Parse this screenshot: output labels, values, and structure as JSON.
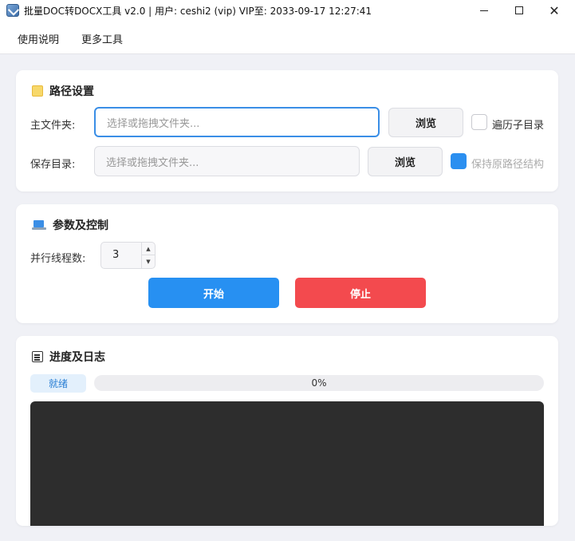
{
  "window": {
    "title": "批量DOC转DOCX工具 v2.0  |  用户: ceshi2 (vip) VIP至: 2033-09-17 12:27:41",
    "minimize_label": "",
    "maximize_label": "",
    "close_label": "✕"
  },
  "menu": {
    "items": [
      {
        "label": "使用说明"
      },
      {
        "label": "更多工具"
      }
    ]
  },
  "path_section": {
    "title": "路径设置",
    "main_folder_label": "主文件夹:",
    "main_folder_placeholder": "选择或拖拽文件夹...",
    "browse_label": "浏览",
    "recurse_label": "遍历子目录",
    "recurse_checked": false,
    "save_dir_label": "保存目录:",
    "save_dir_placeholder": "选择或拖拽文件夹...",
    "keep_structure_label": "保持原路径结构",
    "keep_structure_checked": true
  },
  "params_section": {
    "title": "参数及控制",
    "threads_label": "并行线程数:",
    "threads_value": "3",
    "start_label": "开始",
    "stop_label": "停止"
  },
  "log_section": {
    "title": "进度及日志",
    "status": "就绪",
    "progress_percent": 0,
    "progress_text": "0%"
  },
  "colors": {
    "accent": "#2790f2",
    "stop": "#f34a4e",
    "log_bg": "#2d2d2d"
  }
}
